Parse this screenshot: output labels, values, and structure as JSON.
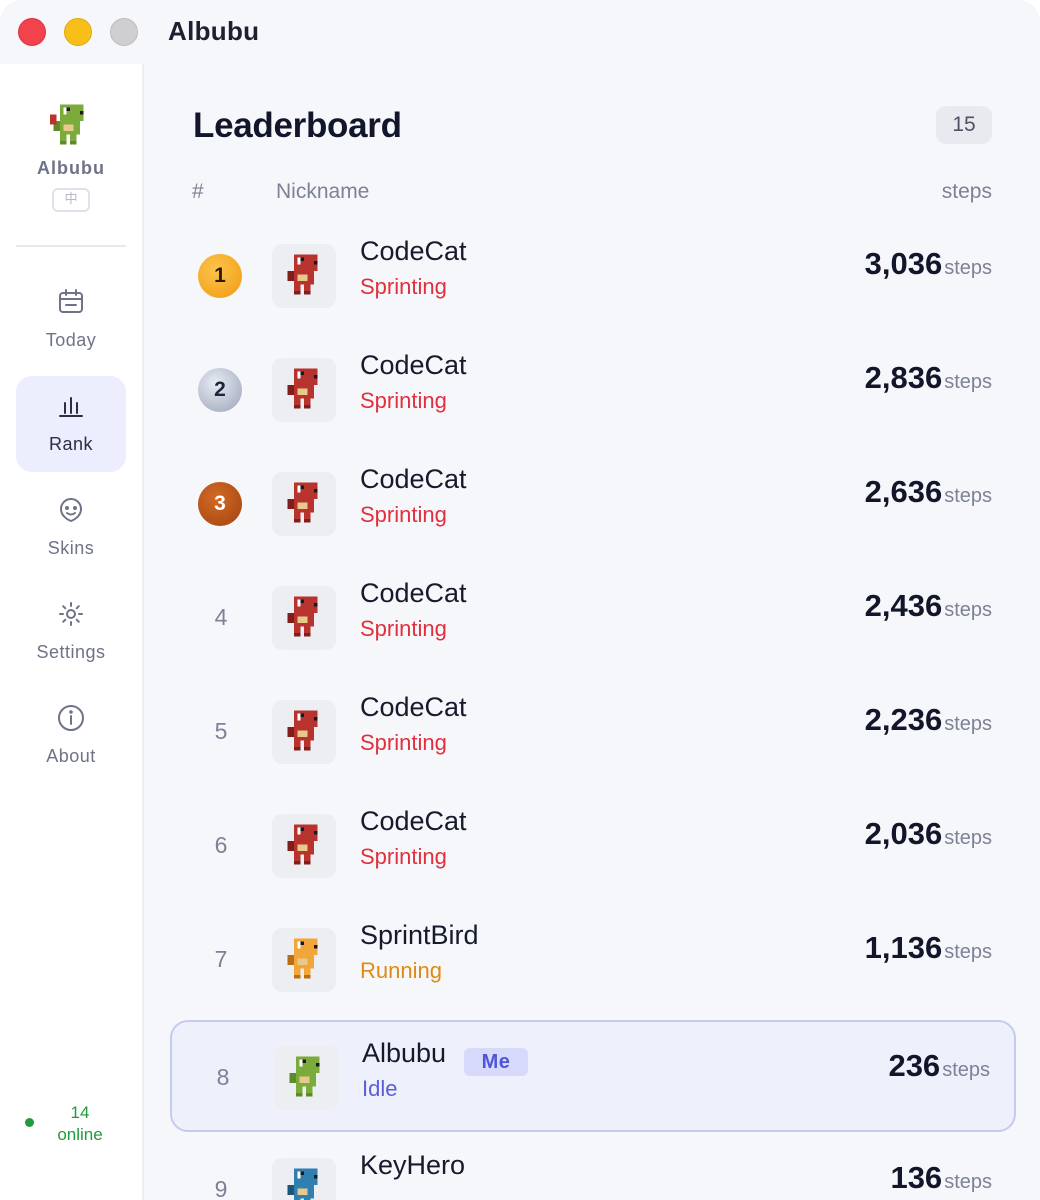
{
  "window": {
    "title": "Albubu"
  },
  "sidebar": {
    "profile_name": "Albubu",
    "lang_badge": "中",
    "items": [
      {
        "label": "Today",
        "icon": "calendar-icon",
        "active": false
      },
      {
        "label": "Rank",
        "icon": "bar-chart-icon",
        "active": true
      },
      {
        "label": "Skins",
        "icon": "smiley-icon",
        "active": false
      },
      {
        "label": "Settings",
        "icon": "sun-gear-icon",
        "active": false
      },
      {
        "label": "About",
        "icon": "info-icon",
        "active": false
      }
    ],
    "online_count": "14",
    "online_label": "online"
  },
  "leaderboard": {
    "title": "Leaderboard",
    "count": "15",
    "columns": {
      "rank": "#",
      "nickname": "Nickname",
      "steps": "steps"
    },
    "rows": [
      {
        "rank": "1",
        "nickname": "CodeCat",
        "status": "Sprinting",
        "steps": "3,036",
        "unit": "steps",
        "skin_color": "#b8332e"
      },
      {
        "rank": "2",
        "nickname": "CodeCat",
        "status": "Sprinting",
        "steps": "2,836",
        "unit": "steps",
        "skin_color": "#b8332e"
      },
      {
        "rank": "3",
        "nickname": "CodeCat",
        "status": "Sprinting",
        "steps": "2,636",
        "unit": "steps",
        "skin_color": "#b8332e"
      },
      {
        "rank": "4",
        "nickname": "CodeCat",
        "status": "Sprinting",
        "steps": "2,436",
        "unit": "steps",
        "skin_color": "#b8332e"
      },
      {
        "rank": "5",
        "nickname": "CodeCat",
        "status": "Sprinting",
        "steps": "2,236",
        "unit": "steps",
        "skin_color": "#b8332e"
      },
      {
        "rank": "6",
        "nickname": "CodeCat",
        "status": "Sprinting",
        "steps": "2,036",
        "unit": "steps",
        "skin_color": "#b8332e"
      },
      {
        "rank": "7",
        "nickname": "SprintBird",
        "status": "Running",
        "steps": "1,136",
        "unit": "steps",
        "skin_color": "#f2a63a"
      },
      {
        "rank": "8",
        "nickname": "Albubu",
        "status": "Idle",
        "steps": "236",
        "unit": "steps",
        "me_label": "Me",
        "skin_color": "#7bab3a"
      },
      {
        "rank": "9",
        "nickname": "KeyHero",
        "status": "",
        "steps": "136",
        "unit": "steps",
        "skin_color": "#2f7fb0"
      }
    ]
  },
  "colors": {
    "sprinting": "#e0303d",
    "running": "#e08a14",
    "idle": "#5a5fd6",
    "online": "#1f9a3c",
    "accent": "#5a5fd6"
  }
}
